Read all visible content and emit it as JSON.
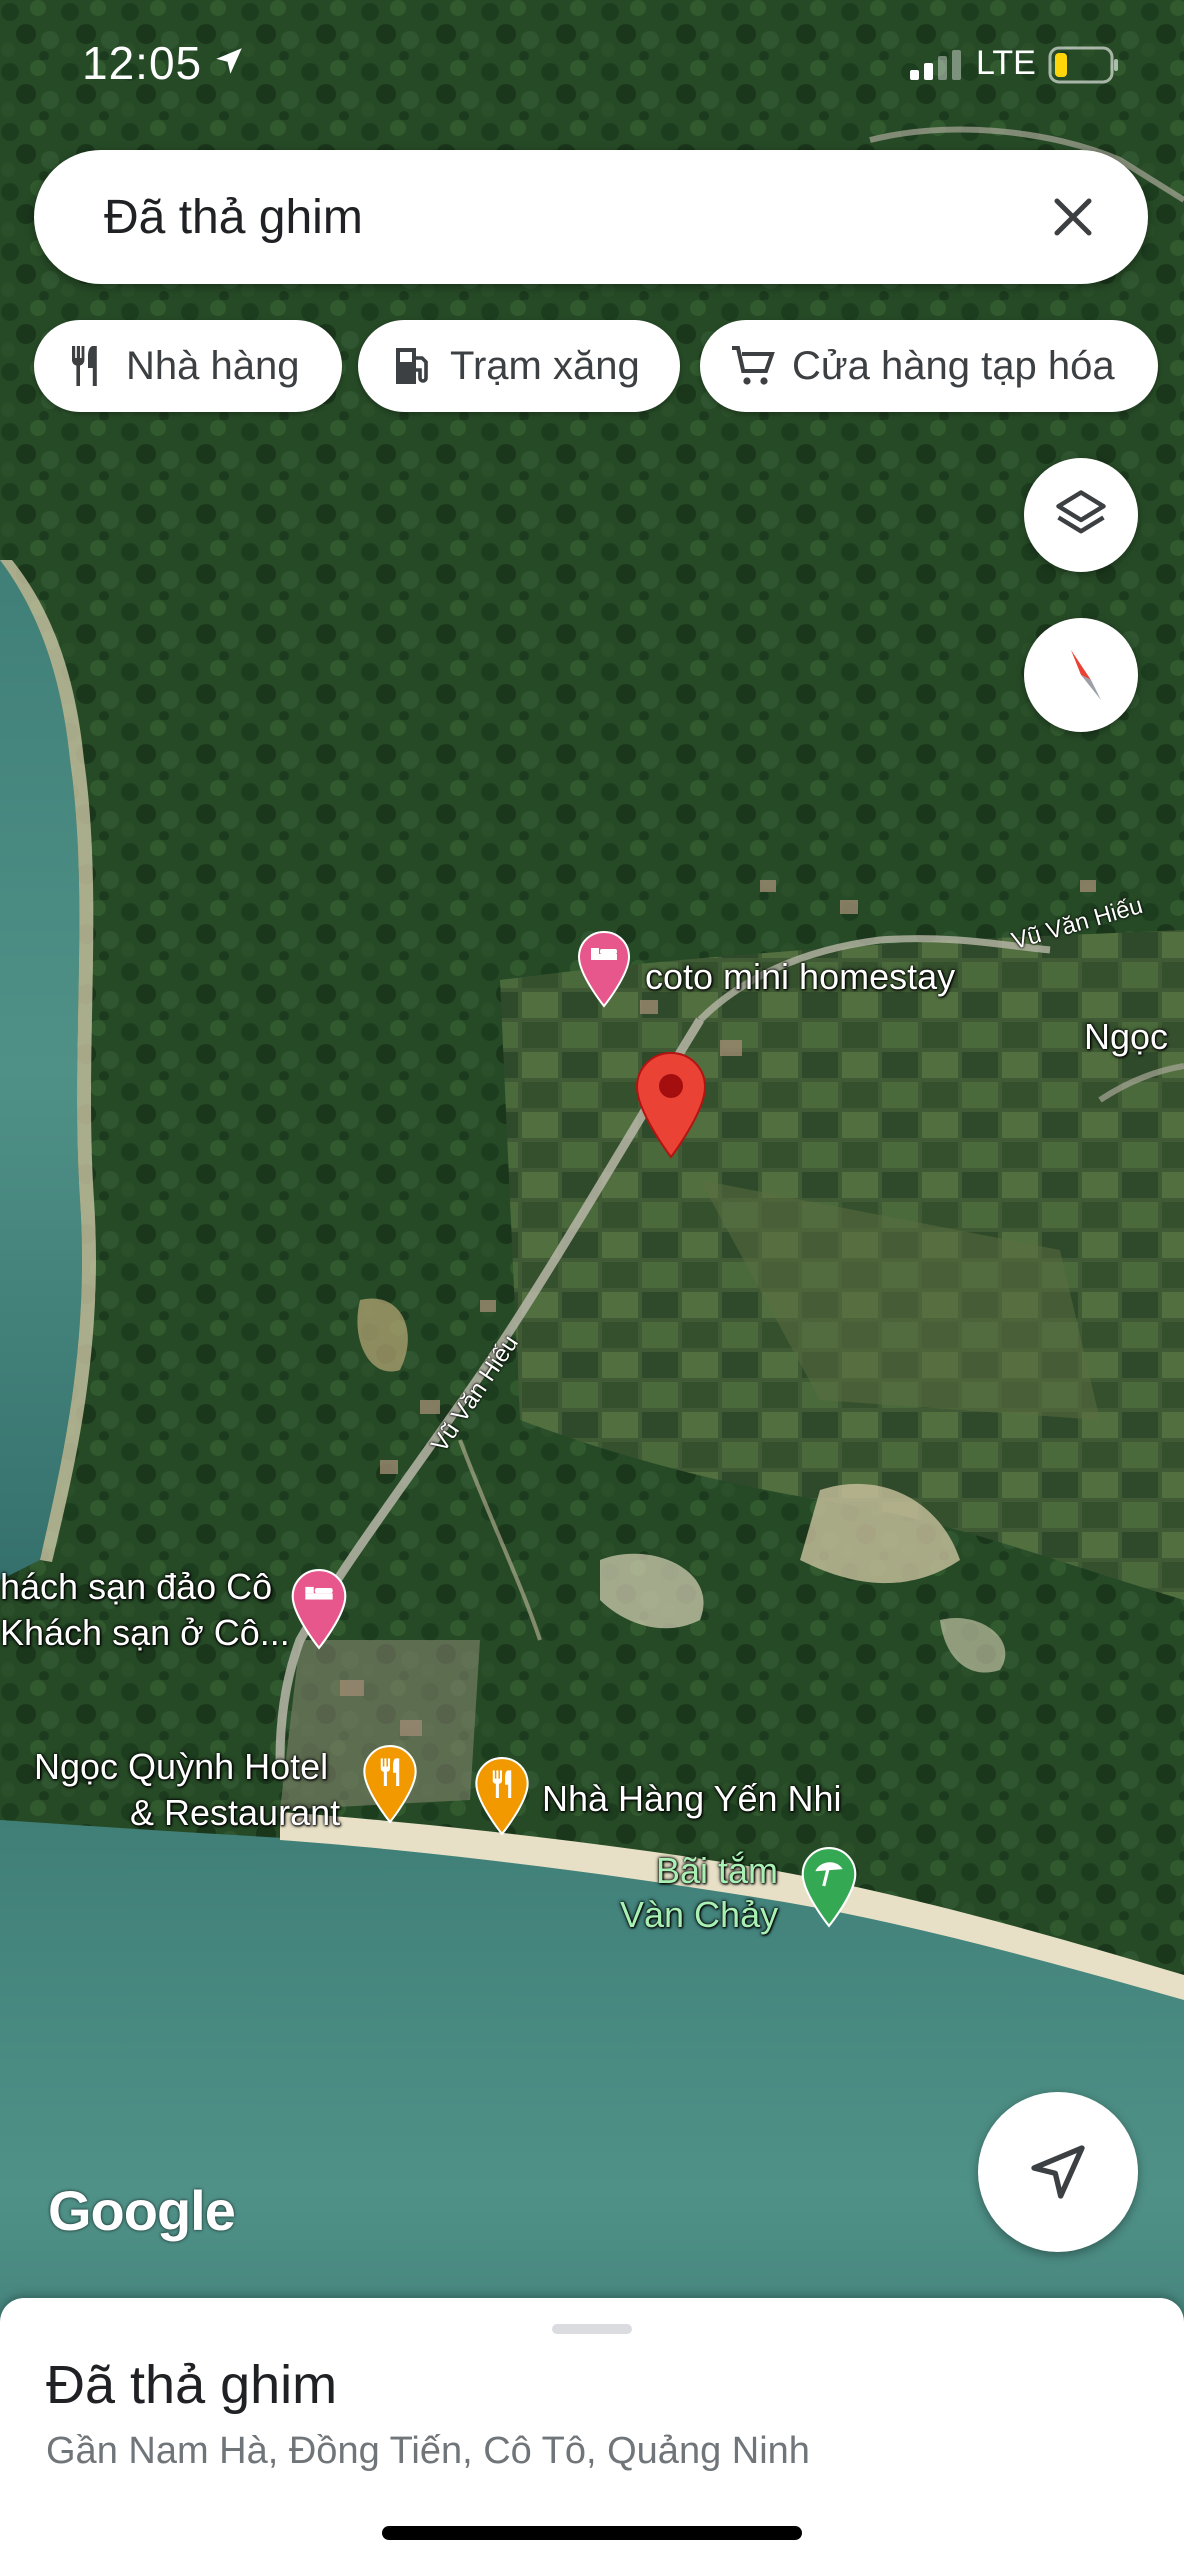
{
  "status_bar": {
    "time": "12:05",
    "network": "LTE"
  },
  "search": {
    "query": "Đã thả ghim"
  },
  "chips": [
    {
      "icon": "restaurant-icon",
      "label": "Nhà hàng"
    },
    {
      "icon": "gas-station-icon",
      "label": "Trạm xăng"
    },
    {
      "icon": "cart-icon",
      "label": "Cửa hàng tạp hóa"
    }
  ],
  "map": {
    "places": {
      "homestay": "coto mini homestay",
      "ngoc": "Ngọc",
      "hotel_1": "hách sạn đảo Cô",
      "hotel_2": "Khách sạn ở Cô...",
      "ngocquynh_1": "Ngọc Quỳnh Hotel",
      "ngocquynh_2": "& Restaurant",
      "yennhi": "Nhà Hàng Yến Nhi",
      "beach_1": "Bãi tắm",
      "beach_2": "Vàn Chảy"
    },
    "roads": {
      "road_1": "Vũ Văn Hiếu",
      "road_2": "Vũ Văn Hiếu"
    },
    "attribution": "Google"
  },
  "colors": {
    "pin_red": "#ea4335",
    "hotel_pink": "#e8578c",
    "restaurant_orange": "#f29900",
    "beach_green": "#34a853"
  },
  "sheet": {
    "title": "Đã thả ghim",
    "address": "Gần Nam Hà, Đồng Tiến, Cô Tô, Quảng Ninh"
  }
}
